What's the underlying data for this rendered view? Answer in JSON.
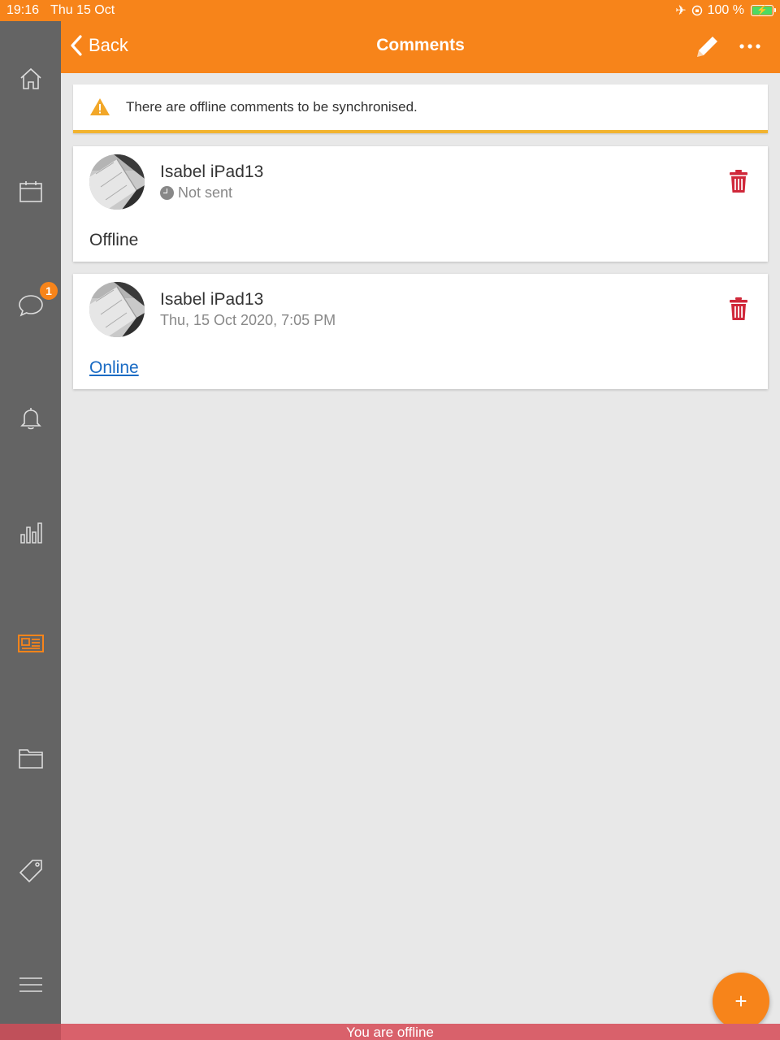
{
  "status": {
    "time": "19:16",
    "date": "Thu 15 Oct",
    "battery": "100 %"
  },
  "sidebar": {
    "items": [
      {
        "name": "home-icon"
      },
      {
        "name": "calendar-icon"
      },
      {
        "name": "chat-icon",
        "badge": "1"
      },
      {
        "name": "bell-icon"
      },
      {
        "name": "bar-chart-icon"
      },
      {
        "name": "newspaper-icon",
        "active": true
      },
      {
        "name": "folder-icon"
      },
      {
        "name": "tag-icon"
      },
      {
        "name": "menu-icon"
      }
    ]
  },
  "navbar": {
    "back_label": "Back",
    "title": "Comments"
  },
  "alert": {
    "text": "There are offline comments to be synchronised."
  },
  "comments": [
    {
      "author": "Isabel iPad13",
      "meta": "Not sent",
      "body": "Offline"
    },
    {
      "author": "Isabel iPad13",
      "meta": "Thu, 15 Oct 2020, 7:05 PM",
      "body": "Online"
    }
  ],
  "fab": {
    "label": "+"
  },
  "offline_banner": {
    "text": "You are offline"
  },
  "colors": {
    "accent": "#f7841a",
    "sidebar": "#646464",
    "danger": "#d0283a",
    "warning": "#f2b32f",
    "offline": "#d9616b"
  }
}
